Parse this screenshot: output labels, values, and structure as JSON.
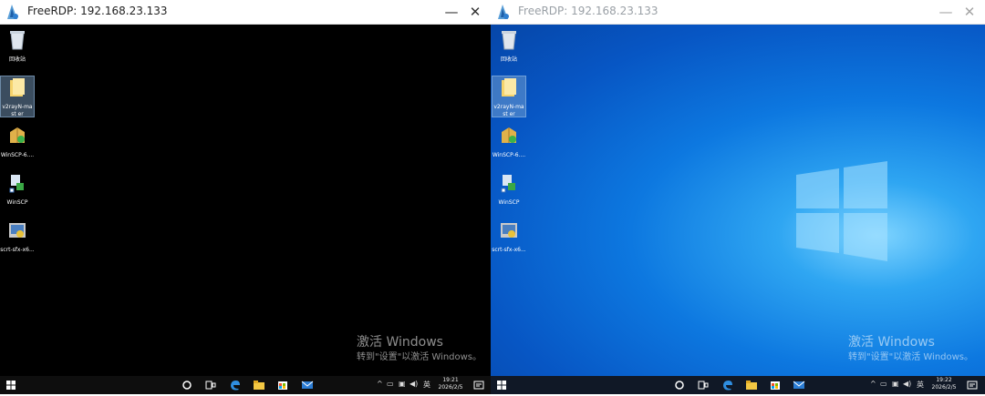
{
  "windows": [
    {
      "title": "FreeRDP: 192.168.23.133",
      "minimize": "—",
      "close": "✕",
      "state": "active",
      "desktop_style": "black",
      "icons": [
        {
          "label": "回收站",
          "icon": "recycle-bin-icon"
        },
        {
          "label": "v2rayN-mast er",
          "icon": "folder-icon",
          "selected": true
        },
        {
          "label": "WinSCP-6....",
          "icon": "winscp-installer-icon"
        },
        {
          "label": "WinSCP",
          "icon": "winscp-icon"
        },
        {
          "label": "scrt-sfx-x6...",
          "icon": "securecrt-icon"
        }
      ],
      "watermark": {
        "line1": "激活 Windows",
        "line2": "转到\"设置\"以激活 Windows。"
      },
      "taskbar": {
        "clock_time": "19:21",
        "clock_date": "2026/2/5",
        "ime": "英"
      }
    },
    {
      "title": "FreeRDP: 192.168.23.133",
      "minimize": "—",
      "close": "✕",
      "state": "inactive",
      "desktop_style": "windows10-blue",
      "icons": [
        {
          "label": "回收站",
          "icon": "recycle-bin-icon"
        },
        {
          "label": "v2rayN-mast er",
          "icon": "folder-icon",
          "selected": true
        },
        {
          "label": "WinSCP-6....",
          "icon": "winscp-installer-icon"
        },
        {
          "label": "WinSCP",
          "icon": "winscp-icon"
        },
        {
          "label": "scrt-sfx-x6...",
          "icon": "securecrt-icon"
        }
      ],
      "watermark": {
        "line1": "激活 Windows",
        "line2": "转到\"设置\"以激活 Windows。"
      },
      "taskbar": {
        "clock_time": "19:22",
        "clock_date": "2026/2/5",
        "ime": "英"
      }
    }
  ],
  "colors": {
    "titlebar": "#ffffff",
    "desktop_left": "#000000",
    "desktop_right": "#0a6fd8",
    "taskbar": "#0e0e0e"
  }
}
